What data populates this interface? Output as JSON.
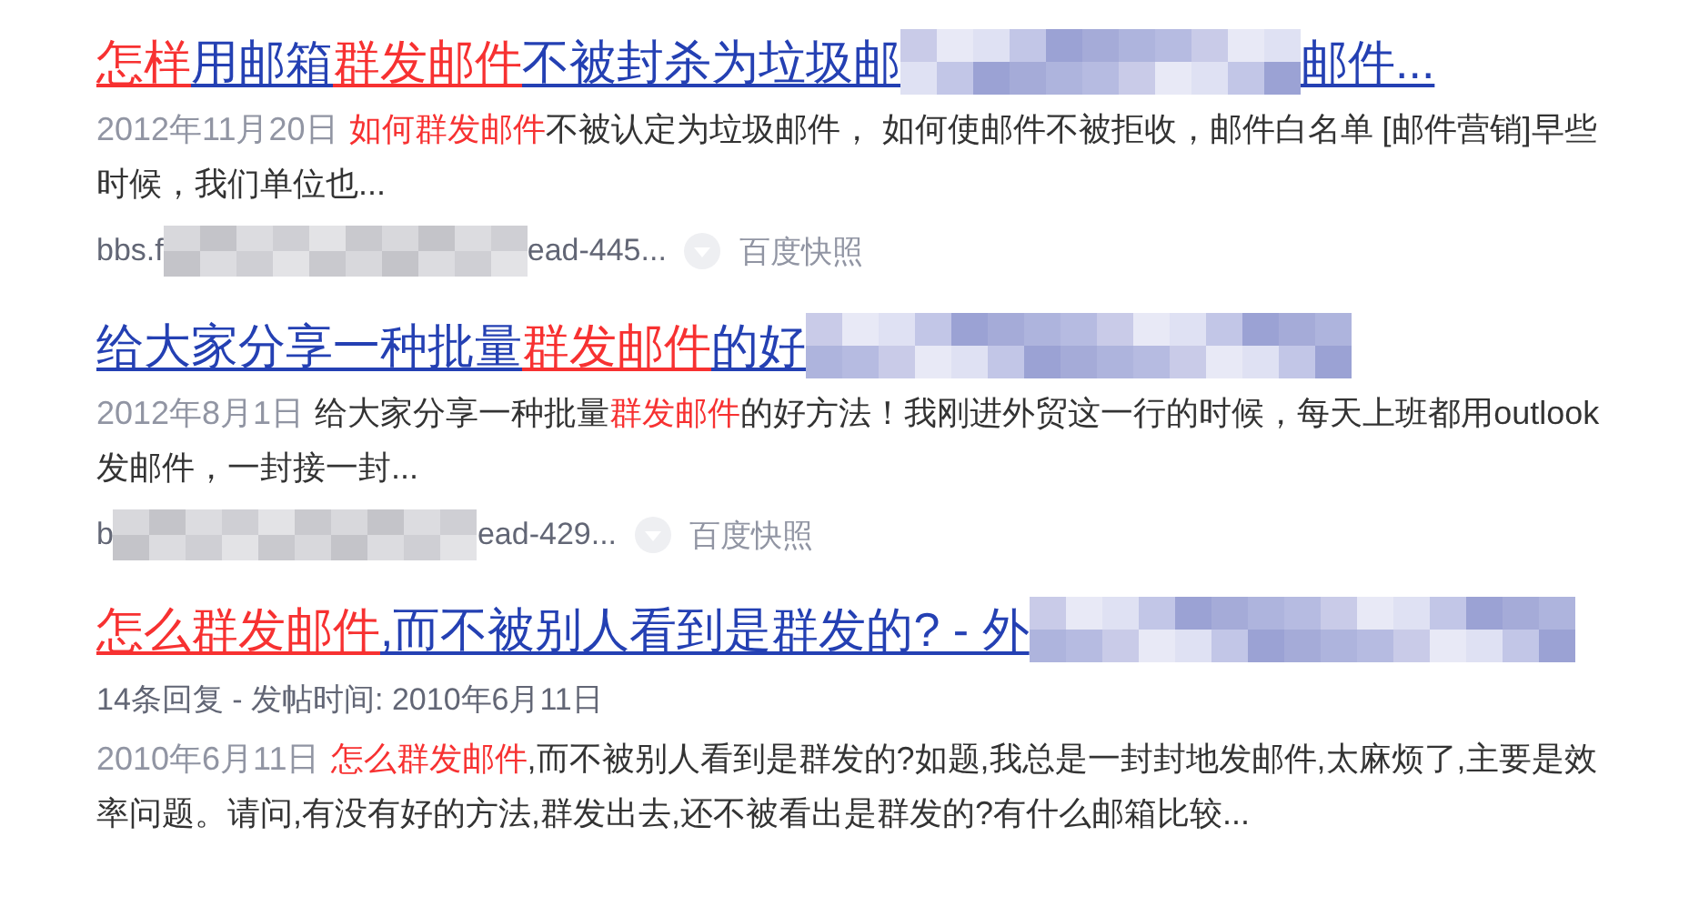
{
  "results": [
    {
      "title": [
        {
          "kind": "text",
          "text": "怎样",
          "highlight": true
        },
        {
          "kind": "text",
          "text": "用邮箱",
          "highlight": false
        },
        {
          "kind": "text",
          "text": "群发邮件",
          "highlight": true
        },
        {
          "kind": "text",
          "text": "不被封杀为垃圾邮",
          "highlight": false
        },
        {
          "kind": "redacted"
        },
        {
          "kind": "text",
          "text": "邮件...",
          "highlight": false
        }
      ],
      "date": "2012年11月20日",
      "snippet": [
        {
          "text": "如何群发邮件",
          "highlight": true
        },
        {
          "text": "不被认定为垃圾邮件， 如何使邮件不被拒收，邮件白名单 [邮件营销]早些时候，我们单位也...",
          "highlight": false
        }
      ],
      "url": [
        {
          "kind": "text",
          "text": "bbs.f"
        },
        {
          "kind": "redacted"
        },
        {
          "kind": "text",
          "text": "ead-445..."
        }
      ],
      "snapshot": "百度快照"
    },
    {
      "title": [
        {
          "kind": "text",
          "text": "给大家分享一种批量",
          "highlight": false
        },
        {
          "kind": "text",
          "text": "群发邮件",
          "highlight": true
        },
        {
          "kind": "text",
          "text": "的好",
          "highlight": false
        },
        {
          "kind": "redacted"
        }
      ],
      "date": "2012年8月1日",
      "snippet": [
        {
          "text": "给大家分享一种批量",
          "highlight": false
        },
        {
          "text": "群发邮件",
          "highlight": true
        },
        {
          "text": "的好方法！我刚进外贸这一行的时候，每天上班都用outlook发邮件，一封接一封...",
          "highlight": false
        }
      ],
      "url": [
        {
          "kind": "text",
          "text": "b"
        },
        {
          "kind": "redacted"
        },
        {
          "kind": "text",
          "text": "ead-429..."
        }
      ],
      "snapshot": "百度快照"
    },
    {
      "title": [
        {
          "kind": "text",
          "text": "怎么群发邮件",
          "highlight": true
        },
        {
          "kind": "text",
          "text": ",而不被别人看到是群发的? - 外",
          "highlight": false
        },
        {
          "kind": "redacted"
        }
      ],
      "meta": "14条回复 - 发帖时间: 2010年6月11日",
      "date": "2010年6月11日",
      "snippet": [
        {
          "text": "怎么群发邮件",
          "highlight": true
        },
        {
          "text": ",而不被别人看到是群发的?如题,我总是一封封地发邮件,太麻烦了,主要是效率问题。请问,有没有好的方法,群发出去,还不被看出是群发的?有什么邮箱比较...",
          "highlight": false
        }
      ]
    }
  ]
}
